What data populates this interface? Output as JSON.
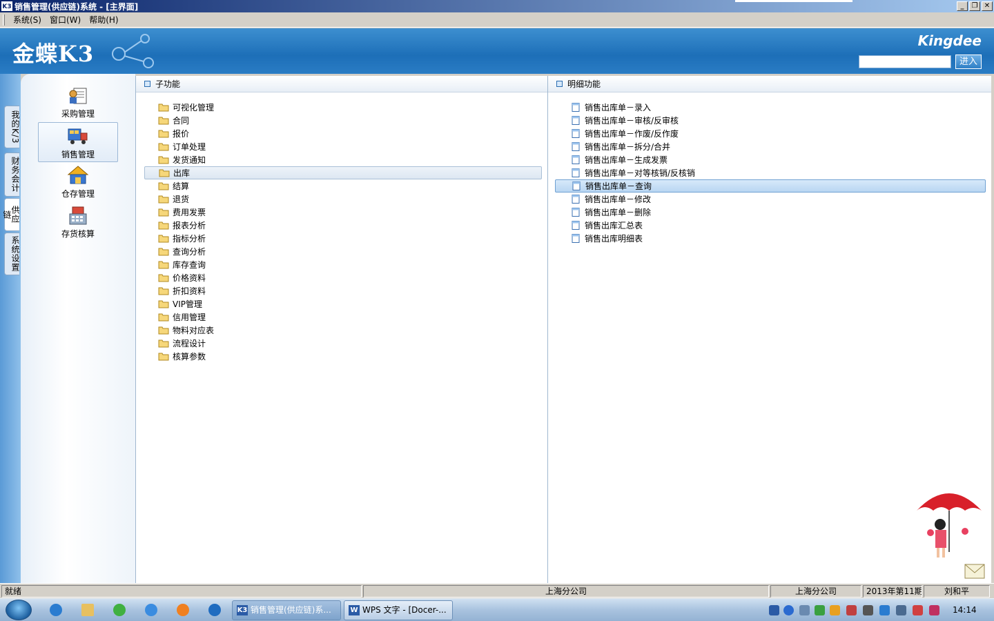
{
  "window": {
    "title": "销售管理(供应链)系统 - [主界面]",
    "app_icon": "K3",
    "minimize": "_",
    "restore": "❐",
    "close": "✕"
  },
  "menu": [
    "系统(S)",
    "窗口(W)",
    "帮助(H)"
  ],
  "banner": {
    "logo": "金蝶K3",
    "brand": "Kingdee",
    "search_value": "",
    "enter_label": "进入"
  },
  "vtabs": [
    "我的K/3",
    "财务会计",
    "供应链",
    "系统设置"
  ],
  "nav": [
    {
      "label": "采购管理",
      "icon": "purchase-icon"
    },
    {
      "label": "销售管理",
      "icon": "sales-truck-icon"
    },
    {
      "label": "仓存管理",
      "icon": "warehouse-icon"
    },
    {
      "label": "存货核算",
      "icon": "inventory-calc-icon"
    }
  ],
  "sub_panel": {
    "title": "子功能",
    "items": [
      "可视化管理",
      "合同",
      "报价",
      "订单处理",
      "发货通知",
      "出库",
      "结算",
      "退货",
      "费用发票",
      "报表分析",
      "指标分析",
      "查询分析",
      "库存查询",
      "价格资料",
      "折扣资料",
      "VIP管理",
      "信用管理",
      "物料对应表",
      "流程设计",
      "核算参数"
    ],
    "highlighted_index": 5
  },
  "detail_panel": {
    "title": "明细功能",
    "items": [
      "销售出库单－录入",
      "销售出库单－审核/反审核",
      "销售出库单－作废/反作废",
      "销售出库单－拆分/合并",
      "销售出库单－生成发票",
      "销售出库单－对等核销/反核销",
      "销售出库单－查询",
      "销售出库单－修改",
      "销售出库单－删除",
      "销售出库汇总表",
      "销售出库明细表"
    ],
    "selected_index": 6
  },
  "status": {
    "ready": "就绪",
    "company_center": "上海分公司",
    "company": "上海分公司",
    "period": "2013年第11期",
    "user": "刘和平"
  },
  "taskbar": {
    "tasks": [
      {
        "label": "销售管理(供应链)系...",
        "icon": "K3"
      },
      {
        "label": "WPS 文字 - [Docer-...",
        "icon": "W"
      }
    ],
    "clock": "14:14"
  },
  "colors": {
    "banner": "#1d6fb8",
    "selection": "#b9d6f2"
  }
}
